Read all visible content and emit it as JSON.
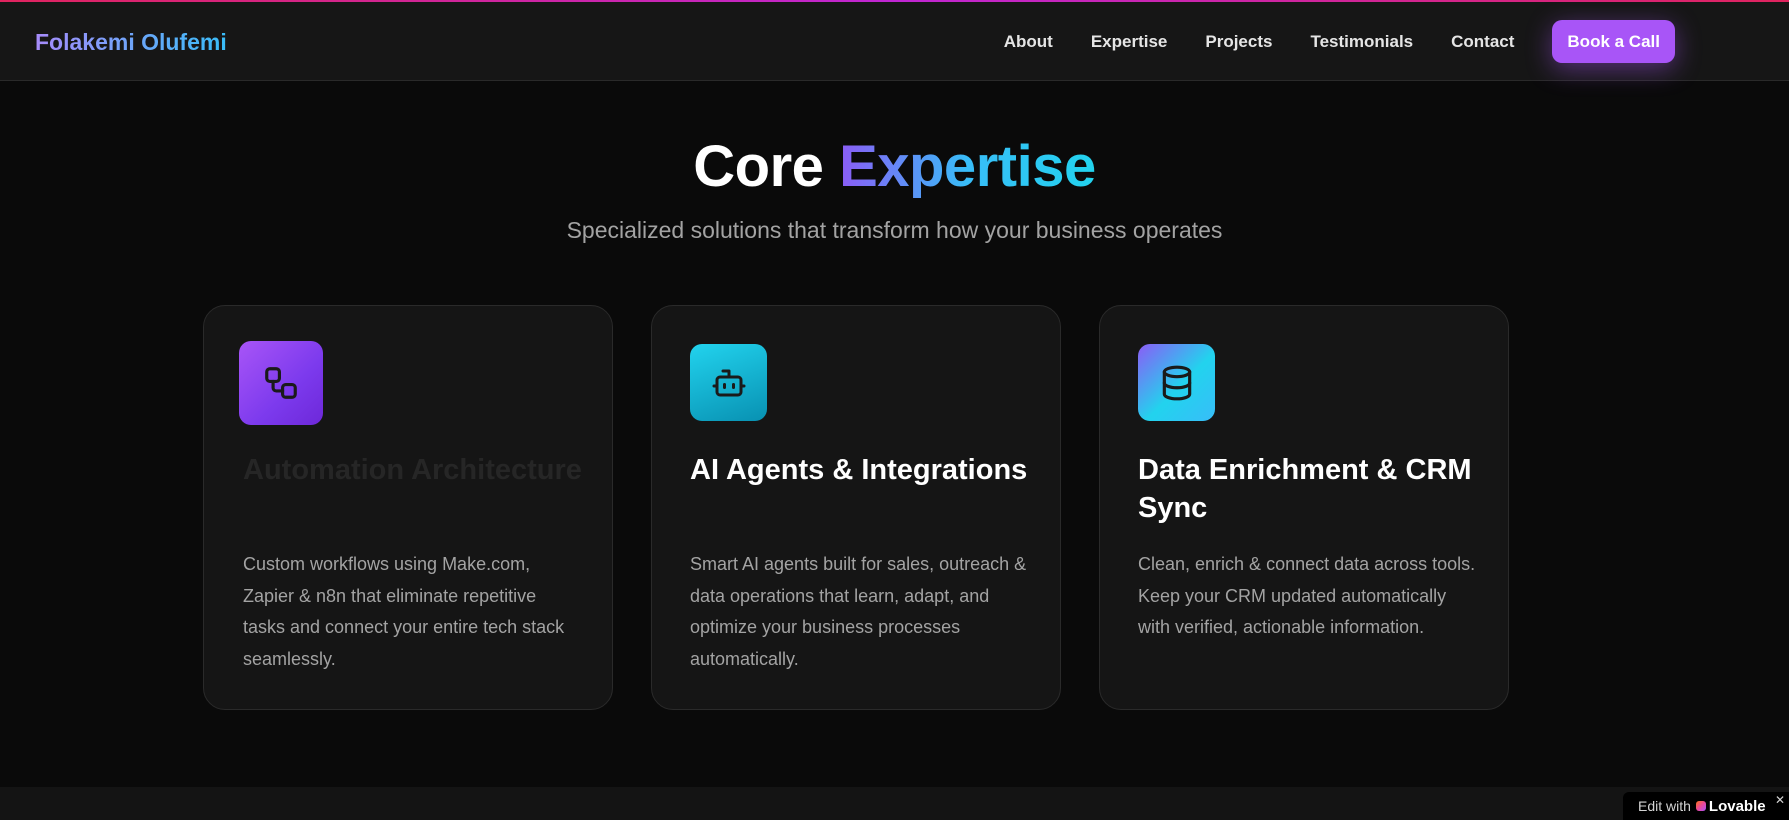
{
  "header": {
    "brand": "Folakemi Olufemi",
    "nav": [
      "About",
      "Expertise",
      "Projects",
      "Testimonials",
      "Contact"
    ],
    "cta_label": "Book a Call"
  },
  "hero": {
    "title_plain": "Core",
    "title_accent": "Expertise",
    "subtitle": "Specialized solutions that transform how your business operates"
  },
  "cards": [
    {
      "icon": "workflow-icon",
      "title": "Automation Architecture",
      "description": "Custom workflows using Make.com, Zapier & n8n that eliminate repetitive tasks and connect your entire tech stack seamlessly."
    },
    {
      "icon": "bot-icon",
      "title": "AI Agents & Integrations",
      "description": "Smart AI agents built for sales, outreach & data operations that learn, adapt, and optimize your business processes automatically."
    },
    {
      "icon": "database-icon",
      "title": "Data Enrichment & CRM Sync",
      "description": "Clean, enrich & connect data across tools. Keep your CRM updated automatically with verified, actionable information."
    }
  ],
  "badge": {
    "prefix": "Edit with",
    "brand": "Lovable",
    "close": "✕"
  },
  "colors": {
    "accent_purple": "#a855f7",
    "accent_cyan": "#22d3ee",
    "background": "#0a0a0a"
  }
}
